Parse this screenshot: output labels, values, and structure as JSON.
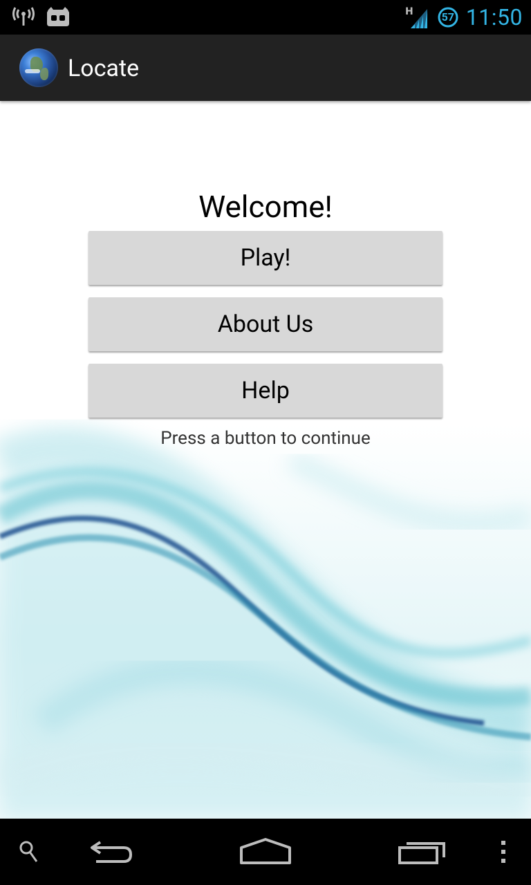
{
  "status_bar": {
    "time": "11:50",
    "network_type": "H",
    "notification_count": "57",
    "icons": [
      "wireless-broadcast-icon",
      "cyanogenmod-icon",
      "signal-strength-icon",
      "notification-count-icon"
    ],
    "accent_color": "#33b5e5"
  },
  "action_bar": {
    "title": "Locate",
    "icon": "earth-globe-icon",
    "background": "#222222"
  },
  "main": {
    "heading": "Welcome!",
    "buttons": [
      {
        "label": "Play!"
      },
      {
        "label": "About Us"
      },
      {
        "label": "Help"
      }
    ],
    "hint": "Press a button to continue",
    "button_color": "#d8d8d8"
  },
  "nav_bar": {
    "items": [
      "search-icon",
      "back-icon",
      "home-icon",
      "recent-apps-icon",
      "menu-overflow-icon"
    ]
  }
}
